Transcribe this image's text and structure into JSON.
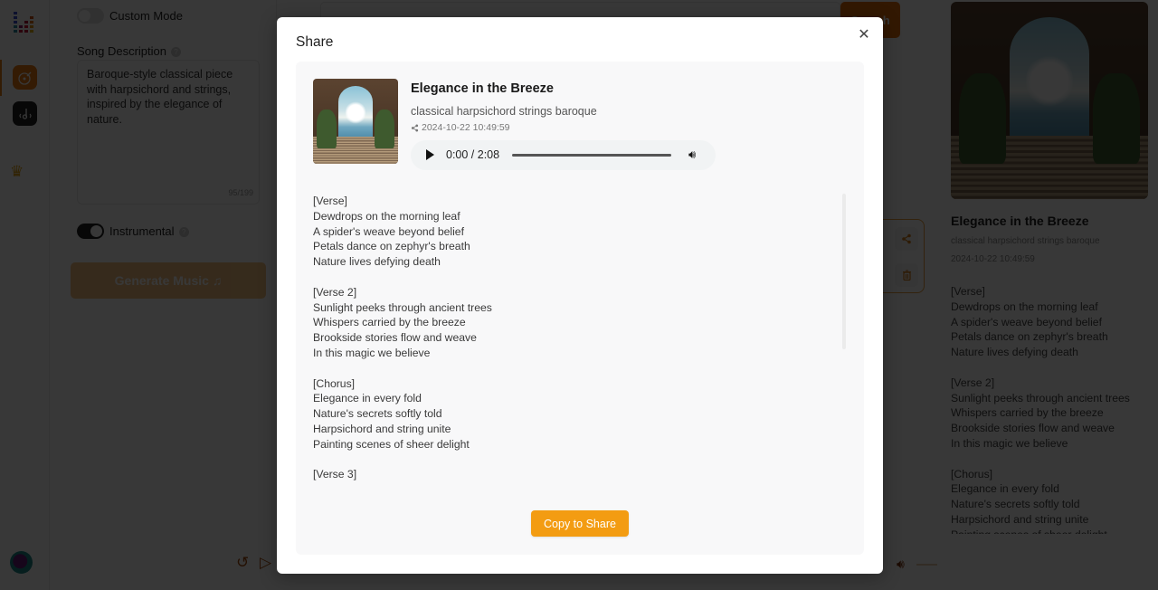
{
  "app": {
    "rail": {
      "items": [
        {
          "name": "create",
          "icon": "vinyl-note-icon",
          "active": true
        },
        {
          "name": "library",
          "icon": "music-wave-icon",
          "active": false
        }
      ],
      "crown_icon": "crown-icon",
      "avatar_icon": "user-avatar"
    },
    "left_panel": {
      "custom_mode_label": "Custom Mode",
      "custom_mode_on": false,
      "song_description_label": "Song Description",
      "song_description_value": "Baroque-style classical piece with harpsichord and strings, inspired by the elegance of nature.",
      "char_count": "95/199",
      "instrumental_label": "Instrumental",
      "instrumental_on": true,
      "generate_label": "Generate Music ♫"
    },
    "center": {
      "search_button_label": "Search",
      "card_actions": [
        "share",
        "delete"
      ]
    },
    "player_bar": {
      "back15_label": "15",
      "volume_percent": 90
    },
    "right_panel": {
      "title": "Elegance in the Breeze",
      "tags": "classical harpsichord strings baroque",
      "date": "2024-10-22 10:49:59",
      "lyrics": "[Verse]\nDewdrops on the morning leaf\nA spider's weave beyond belief\nPetals dance on zephyr's breath\nNature lives defying death\n\n[Verse 2]\nSunlight peeks through ancient trees\nWhispers carried by the breeze\nBrookside stories flow and weave\nIn this magic we believe\n\n[Chorus]\nElegance in every fold\nNature's secrets softly told\nHarpsichord and string unite\nPainting scenes of sheer delight"
    }
  },
  "modal": {
    "title": "Share",
    "close_icon": "close-icon",
    "song": {
      "title": "Elegance in the Breeze",
      "tags": "classical harpsichord strings baroque",
      "date": "2024-10-22 10:49:59",
      "player": {
        "time": "0:00 / 2:08",
        "progress": 0
      },
      "lyrics": "[Verse]\nDewdrops on the morning leaf\nA spider's weave beyond belief\nPetals dance on zephyr's breath\nNature lives defying death\n\n[Verse 2]\nSunlight peeks through ancient trees\nWhispers carried by the breeze\nBrookside stories flow and weave\nIn this magic we believe\n\n[Chorus]\nElegance in every fold\nNature's secrets softly told\nHarpsichord and string unite\nPainting scenes of sheer delight\n\n[Verse 3]"
    },
    "copy_button_label": "Copy to Share",
    "accent_color": "#f39c12"
  }
}
